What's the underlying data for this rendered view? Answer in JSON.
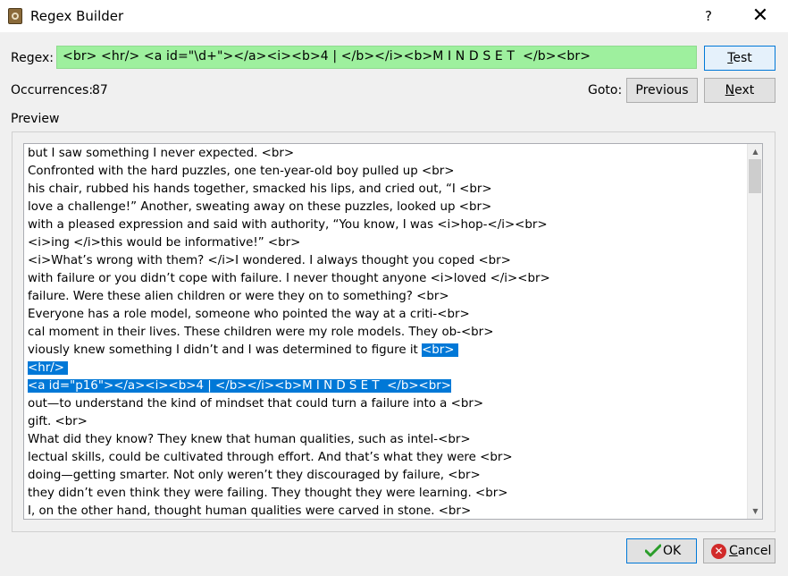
{
  "window": {
    "title": "Regex Builder",
    "help_label": "?",
    "close_label": "✕"
  },
  "regex": {
    "label": "Regex:",
    "value": "<br> <hr/> <a id=\"\\d+\"></a><i><b>4 | </b></i><b>M I N D S E T  </b><br>",
    "bg_color": "#9ef09e"
  },
  "buttons": {
    "test_label_u": "T",
    "test_label_rest": "est",
    "previous_label": "Previous",
    "next_label_u": "N",
    "next_label_rest": "ext",
    "ok_label": "OK",
    "cancel_label_u": "C",
    "cancel_label_rest": "ancel"
  },
  "occurrences": {
    "label": "Occurrences:",
    "count": "87"
  },
  "goto": {
    "label": "Goto:"
  },
  "preview": {
    "label": "Preview",
    "highlight_color": "#0078d7",
    "lines": [
      {
        "before": "but I saw something I never expected. <br>",
        "hl": "",
        "after": ""
      },
      {
        "before": "Confronted with the hard puzzles, one ten-year-old boy pulled up <br>",
        "hl": "",
        "after": ""
      },
      {
        "before": "his chair, rubbed his hands together, smacked his lips, and cried out, “I <br>",
        "hl": "",
        "after": ""
      },
      {
        "before": "love a challenge!” Another, sweating away on these puzzles, looked up <br>",
        "hl": "",
        "after": ""
      },
      {
        "before": "with a pleased expression and said with authority, “You know, I was <i>hop-</i><br>",
        "hl": "",
        "after": ""
      },
      {
        "before": "<i>ing </i>this would be informative!” <br>",
        "hl": "",
        "after": ""
      },
      {
        "before": "<i>What’s wrong with them? </i>I wondered. I always thought you coped <br>",
        "hl": "",
        "after": ""
      },
      {
        "before": "with failure or you didn’t cope with failure. I never thought anyone <i>loved </i><br>",
        "hl": "",
        "after": ""
      },
      {
        "before": "failure. Were these alien children or were they on to something? <br>",
        "hl": "",
        "after": ""
      },
      {
        "before": "Everyone has a role model, someone who pointed the way at a criti-<br>",
        "hl": "",
        "after": ""
      },
      {
        "before": "cal moment in their lives. These children were my role models. They ob-<br>",
        "hl": "",
        "after": ""
      },
      {
        "before": "viously knew something I didn’t and I was determined to figure it ",
        "hl": "<br> ",
        "after": ""
      },
      {
        "before": "",
        "hl": "<hr/> ",
        "after": ""
      },
      {
        "before": "",
        "hl": "<a id=\"p16\"></a><i><b>4 | </b></i><b>M I N D S E T  </b><br>",
        "after": ""
      },
      {
        "before": "out—to understand the kind of mindset that could turn a failure into a <br>",
        "hl": "",
        "after": ""
      },
      {
        "before": "gift. <br>",
        "hl": "",
        "after": ""
      },
      {
        "before": "What did they know? They knew that human qualities, such as intel-<br>",
        "hl": "",
        "after": ""
      },
      {
        "before": "lectual skills, could be cultivated through effort. And that’s what they were <br>",
        "hl": "",
        "after": ""
      },
      {
        "before": "doing—getting smarter. Not only weren’t they discouraged by failure, <br>",
        "hl": "",
        "after": ""
      },
      {
        "before": "they didn’t even think they were failing. They thought they were learning. <br>",
        "hl": "",
        "after": ""
      },
      {
        "before": "I, on the other hand, thought human qualities were carved in stone. <br>",
        "hl": "",
        "after": ""
      }
    ]
  },
  "icons": {
    "app": "app-icon",
    "ok": "checkmark-icon",
    "cancel": "cancel-x-icon",
    "scroll_up": "scroll-up-arrow-icon",
    "scroll_down": "scroll-down-arrow-icon"
  }
}
